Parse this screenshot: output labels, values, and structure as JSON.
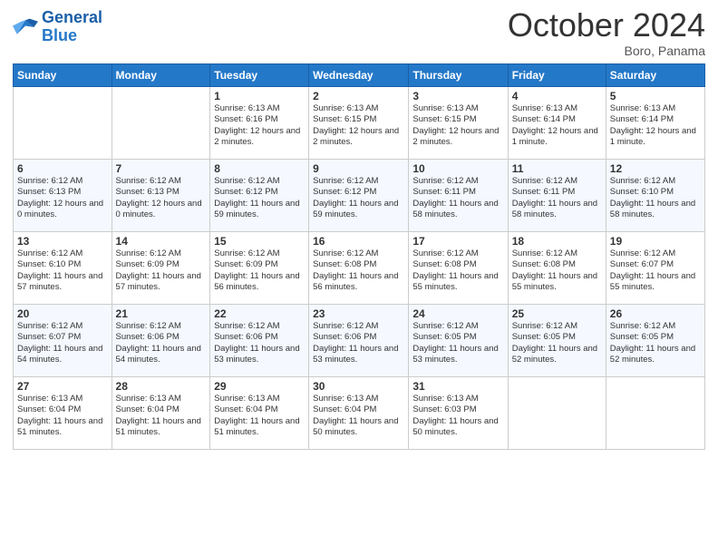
{
  "header": {
    "logo_line1": "General",
    "logo_line2": "Blue",
    "month_title": "October 2024",
    "location": "Boro, Panama"
  },
  "weekdays": [
    "Sunday",
    "Monday",
    "Tuesday",
    "Wednesday",
    "Thursday",
    "Friday",
    "Saturday"
  ],
  "weeks": [
    [
      null,
      null,
      {
        "day": 1,
        "sunrise": "6:13 AM",
        "sunset": "6:16 PM",
        "daylight": "12 hours and 2 minutes."
      },
      {
        "day": 2,
        "sunrise": "6:13 AM",
        "sunset": "6:15 PM",
        "daylight": "12 hours and 2 minutes."
      },
      {
        "day": 3,
        "sunrise": "6:13 AM",
        "sunset": "6:15 PM",
        "daylight": "12 hours and 2 minutes."
      },
      {
        "day": 4,
        "sunrise": "6:13 AM",
        "sunset": "6:14 PM",
        "daylight": "12 hours and 1 minute."
      },
      {
        "day": 5,
        "sunrise": "6:13 AM",
        "sunset": "6:14 PM",
        "daylight": "12 hours and 1 minute."
      }
    ],
    [
      {
        "day": 6,
        "sunrise": "6:12 AM",
        "sunset": "6:13 PM",
        "daylight": "12 hours and 0 minutes."
      },
      {
        "day": 7,
        "sunrise": "6:12 AM",
        "sunset": "6:13 PM",
        "daylight": "12 hours and 0 minutes."
      },
      {
        "day": 8,
        "sunrise": "6:12 AM",
        "sunset": "6:12 PM",
        "daylight": "11 hours and 59 minutes."
      },
      {
        "day": 9,
        "sunrise": "6:12 AM",
        "sunset": "6:12 PM",
        "daylight": "11 hours and 59 minutes."
      },
      {
        "day": 10,
        "sunrise": "6:12 AM",
        "sunset": "6:11 PM",
        "daylight": "11 hours and 58 minutes."
      },
      {
        "day": 11,
        "sunrise": "6:12 AM",
        "sunset": "6:11 PM",
        "daylight": "11 hours and 58 minutes."
      },
      {
        "day": 12,
        "sunrise": "6:12 AM",
        "sunset": "6:10 PM",
        "daylight": "11 hours and 58 minutes."
      }
    ],
    [
      {
        "day": 13,
        "sunrise": "6:12 AM",
        "sunset": "6:10 PM",
        "daylight": "11 hours and 57 minutes."
      },
      {
        "day": 14,
        "sunrise": "6:12 AM",
        "sunset": "6:09 PM",
        "daylight": "11 hours and 57 minutes."
      },
      {
        "day": 15,
        "sunrise": "6:12 AM",
        "sunset": "6:09 PM",
        "daylight": "11 hours and 56 minutes."
      },
      {
        "day": 16,
        "sunrise": "6:12 AM",
        "sunset": "6:08 PM",
        "daylight": "11 hours and 56 minutes."
      },
      {
        "day": 17,
        "sunrise": "6:12 AM",
        "sunset": "6:08 PM",
        "daylight": "11 hours and 55 minutes."
      },
      {
        "day": 18,
        "sunrise": "6:12 AM",
        "sunset": "6:08 PM",
        "daylight": "11 hours and 55 minutes."
      },
      {
        "day": 19,
        "sunrise": "6:12 AM",
        "sunset": "6:07 PM",
        "daylight": "11 hours and 55 minutes."
      }
    ],
    [
      {
        "day": 20,
        "sunrise": "6:12 AM",
        "sunset": "6:07 PM",
        "daylight": "11 hours and 54 minutes."
      },
      {
        "day": 21,
        "sunrise": "6:12 AM",
        "sunset": "6:06 PM",
        "daylight": "11 hours and 54 minutes."
      },
      {
        "day": 22,
        "sunrise": "6:12 AM",
        "sunset": "6:06 PM",
        "daylight": "11 hours and 53 minutes."
      },
      {
        "day": 23,
        "sunrise": "6:12 AM",
        "sunset": "6:06 PM",
        "daylight": "11 hours and 53 minutes."
      },
      {
        "day": 24,
        "sunrise": "6:12 AM",
        "sunset": "6:05 PM",
        "daylight": "11 hours and 53 minutes."
      },
      {
        "day": 25,
        "sunrise": "6:12 AM",
        "sunset": "6:05 PM",
        "daylight": "11 hours and 52 minutes."
      },
      {
        "day": 26,
        "sunrise": "6:12 AM",
        "sunset": "6:05 PM",
        "daylight": "11 hours and 52 minutes."
      }
    ],
    [
      {
        "day": 27,
        "sunrise": "6:13 AM",
        "sunset": "6:04 PM",
        "daylight": "11 hours and 51 minutes."
      },
      {
        "day": 28,
        "sunrise": "6:13 AM",
        "sunset": "6:04 PM",
        "daylight": "11 hours and 51 minutes."
      },
      {
        "day": 29,
        "sunrise": "6:13 AM",
        "sunset": "6:04 PM",
        "daylight": "11 hours and 51 minutes."
      },
      {
        "day": 30,
        "sunrise": "6:13 AM",
        "sunset": "6:04 PM",
        "daylight": "11 hours and 50 minutes."
      },
      {
        "day": 31,
        "sunrise": "6:13 AM",
        "sunset": "6:03 PM",
        "daylight": "11 hours and 50 minutes."
      },
      null,
      null
    ]
  ],
  "labels": {
    "sunrise_label": "Sunrise:",
    "sunset_label": "Sunset:",
    "daylight_label": "Daylight:"
  }
}
